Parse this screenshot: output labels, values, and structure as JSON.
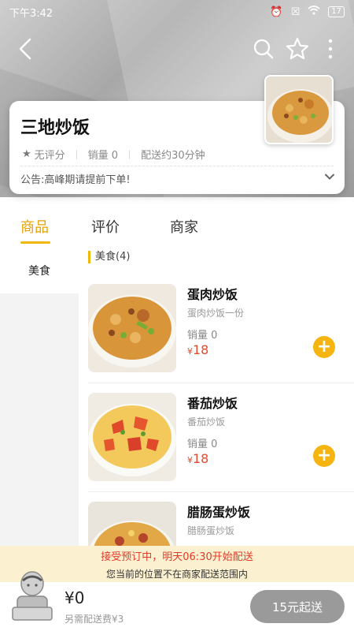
{
  "status_bar": {
    "time": "下午3:42",
    "battery": "17"
  },
  "shop": {
    "name": "三地炒饭",
    "rating": "无评分",
    "sales": "销量 0",
    "delivery": "配送约30分钟",
    "notice": "公告:高峰期请提前下单!"
  },
  "tabs": [
    "商品",
    "评价",
    "商家"
  ],
  "sidebar": {
    "items": [
      {
        "label": "美食"
      }
    ]
  },
  "category": {
    "title": "美食(4)"
  },
  "products": [
    {
      "name": "蛋肉炒饭",
      "desc": "蛋肉炒饭一份",
      "sales": "销量 0",
      "price_symbol": "¥",
      "price": "18"
    },
    {
      "name": "番茄炒饭",
      "desc": "番茄炒饭",
      "sales": "销量 0",
      "price_symbol": "¥",
      "price": "18"
    },
    {
      "name": "腊肠蛋炒饭",
      "desc": "腊肠蛋炒饭",
      "sales": "",
      "price_symbol": "",
      "price": ""
    }
  ],
  "notices": {
    "preorder": "接受预订中，明天06:30开始配送",
    "out_of_range": "您当前的位置不在商家配送范围内"
  },
  "cart": {
    "total": "¥0",
    "delivery_fee": "另需配送费¥3",
    "checkout_label": "15元起送"
  },
  "colors": {
    "accent": "#f1b80c",
    "price": "#e14a2a",
    "notice_bg": "#fbf0cf",
    "checkout_disabled": "#9a9a9a"
  }
}
